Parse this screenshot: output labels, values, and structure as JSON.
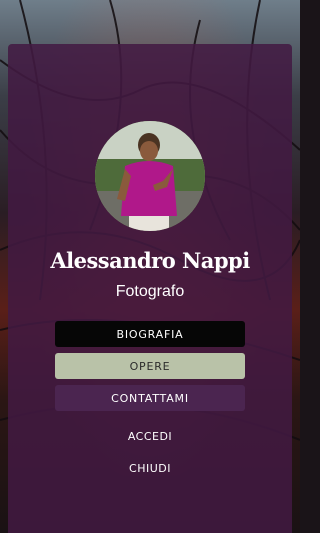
{
  "profile": {
    "name": "Alessandro Nappi",
    "role": "Fotografo"
  },
  "menu": {
    "biography_label": "BIOGRAFIA",
    "works_label": "OPERE",
    "contact_label": "CONTATTAMI"
  },
  "links": {
    "login_label": "ACCEDI",
    "close_label": "CHIUDI"
  },
  "colors": {
    "panel": "#421a42",
    "biography_button": "#060606",
    "works_button": "#b9c2a8",
    "contact_button": "#4b2550"
  }
}
